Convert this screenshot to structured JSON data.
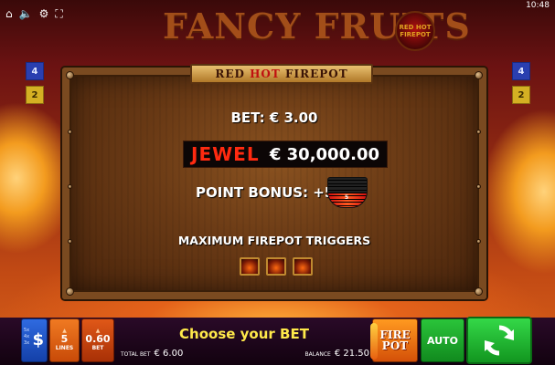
{
  "status_bar": {
    "clock": "10:48"
  },
  "game": {
    "title": "FANCY FRUITS",
    "logo_text": "RED HOT FIREPOT"
  },
  "side_lines": {
    "left": [
      "4",
      "2"
    ],
    "right": [
      "4",
      "2"
    ]
  },
  "paytable": {
    "title_part1": "RED",
    "title_hot": "HOT",
    "title_part2": "FIREPOT",
    "bet": "BET: € 3.00",
    "jewel_label": "JEWEL",
    "jewel_value": "€ 30,000.00",
    "point_bonus": "POINT BONUS: +5",
    "meter_number": "5",
    "meter_level_fraction": 0.5,
    "max_triggers": "MAXIMUM FIREPOT TRIGGERS",
    "trigger_icon_count": 3
  },
  "bottom_bar": {
    "lines_value": "5",
    "lines_label": "LINES",
    "bet_value": "0.60",
    "bet_label": "BET",
    "prompt": "Choose your BET",
    "total_bet_label": "TOTAL BET",
    "total_bet_value": "€ 6.00",
    "balance_label": "BALANCE",
    "balance_value": "€ 21.50",
    "firepot_line1": "FIRE",
    "firepot_line2": "POT",
    "auto_label": "AUTO"
  },
  "icons": [
    "home-icon",
    "sound-icon",
    "gear-icon",
    "fullscreen-icon",
    "dollar-icon",
    "spin-icon"
  ],
  "colors": {
    "jewel_red": "#ff2a10",
    "prompt_yellow": "#ffe94a",
    "spin_green": "#2ac43a",
    "panel_brown": "#6a3a15"
  }
}
